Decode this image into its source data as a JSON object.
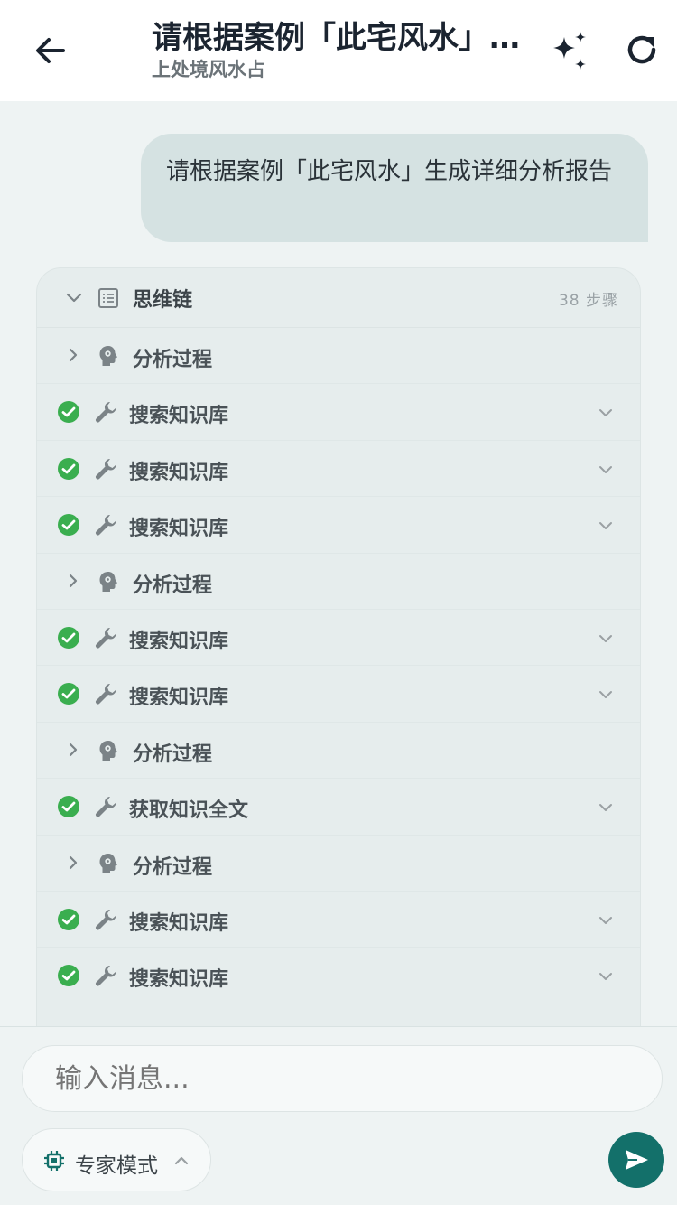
{
  "header": {
    "title": "请根据案例「此宅风水」生成详细分析报告",
    "subtitle": "上处境风水占"
  },
  "chat": {
    "user_message": "请根据案例「此宅风水」生成详细分析报告"
  },
  "chain": {
    "label": "思维链",
    "steps_text": "38 步骤",
    "rows": [
      {
        "kind": "analysis",
        "label": "分析过程"
      },
      {
        "kind": "tool",
        "label": "搜索知识库"
      },
      {
        "kind": "tool",
        "label": "搜索知识库"
      },
      {
        "kind": "tool",
        "label": "搜索知识库"
      },
      {
        "kind": "analysis",
        "label": "分析过程"
      },
      {
        "kind": "tool",
        "label": "搜索知识库"
      },
      {
        "kind": "tool",
        "label": "搜索知识库"
      },
      {
        "kind": "analysis",
        "label": "分析过程"
      },
      {
        "kind": "tool",
        "label": "获取知识全文"
      },
      {
        "kind": "analysis",
        "label": "分析过程"
      },
      {
        "kind": "tool",
        "label": "搜索知识库"
      },
      {
        "kind": "tool",
        "label": "搜索知识库"
      }
    ]
  },
  "composer": {
    "placeholder": "输入消息...",
    "mode_label": "专家模式"
  },
  "colors": {
    "accent": "#13706a",
    "success": "#3aae4f",
    "bubble": "#d5e2e2"
  },
  "icons": {
    "back": "arrow-left-icon",
    "sparkle": "sparkle-icon",
    "refresh": "refresh-icon",
    "send": "send-icon",
    "chip": "chip-icon"
  }
}
